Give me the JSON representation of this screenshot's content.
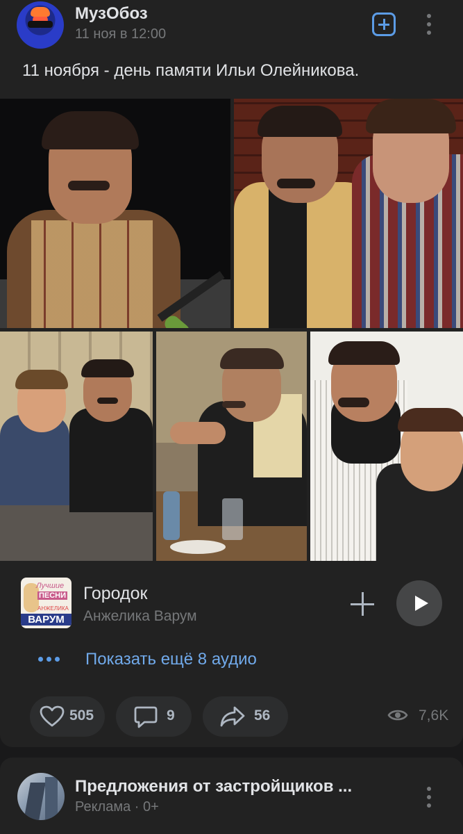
{
  "post": {
    "author": "МузОбоз",
    "date": "11 ноя в 12:00",
    "text": "11 ноября - день памяти Ильи Олейникова."
  },
  "photos": [
    {
      "icon": "photo-portrait-microphone"
    },
    {
      "icon": "photo-two-men-brick-wall"
    },
    {
      "icon": "photo-two-men-street"
    },
    {
      "icon": "photo-man-at-table"
    },
    {
      "icon": "photo-two-men-smiling"
    }
  ],
  "audio": {
    "title": "Городок",
    "artist": "Анжелика Варум",
    "cover_text_top": "Лучшие",
    "cover_text_mid": "ПЕСНИ",
    "cover_text_artist": "АНЖЕЛИКА",
    "cover_text_name": "ВАРУМ",
    "show_more": "Показать ещё 8 аудио"
  },
  "actions": {
    "likes": "505",
    "comments": "9",
    "shares": "56",
    "views": "7,6K"
  },
  "next_post": {
    "title": "Предложения от застройщиков ...",
    "subtitle": "Реклама · 0+"
  },
  "colors": {
    "background": "#19191a",
    "card": "#222222",
    "accent": "#71aaeb",
    "secondary_text": "#76787a"
  }
}
